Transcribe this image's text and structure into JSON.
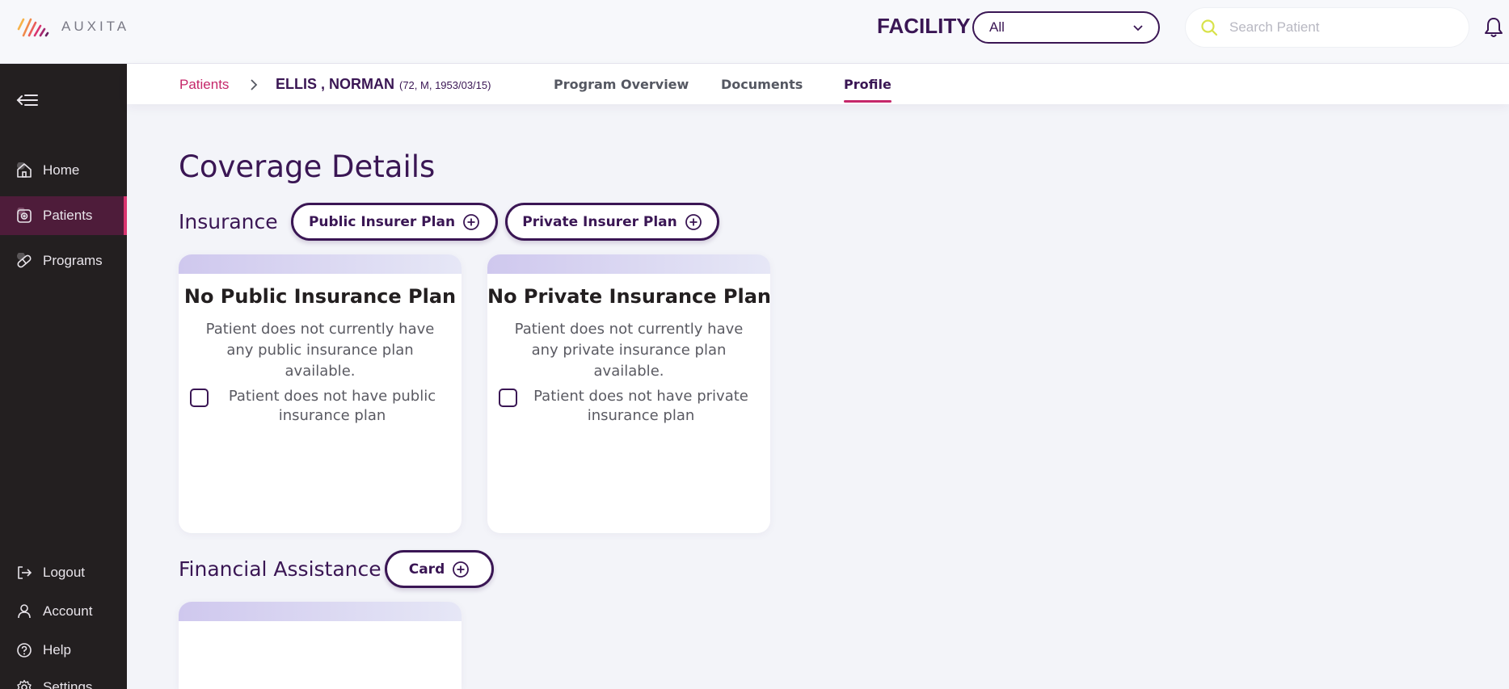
{
  "app": {
    "logo_text": "AUXITA"
  },
  "header": {
    "facility_label": "FACILITY",
    "facility_value": "All",
    "search_placeholder": "Search Patient"
  },
  "sidebar": {
    "items": [
      {
        "label": "Home",
        "icon": "home-icon"
      },
      {
        "label": "Patients",
        "icon": "patients-icon",
        "active": true
      },
      {
        "label": "Programs",
        "icon": "pill-icon"
      },
      {
        "label": "Logout",
        "icon": "logout-icon"
      },
      {
        "label": "Account",
        "icon": "user-icon"
      },
      {
        "label": "Help",
        "icon": "help-icon"
      },
      {
        "label": "Settings",
        "icon": "gear-icon"
      }
    ]
  },
  "breadcrumb": {
    "root": "Patients",
    "patient_name": "ELLIS , NORMAN",
    "patient_meta": "(72, M, 1953/03/15)"
  },
  "tabs": [
    {
      "label": "Program Overview"
    },
    {
      "label": "Documents"
    },
    {
      "label": "Profile",
      "active": true
    }
  ],
  "main": {
    "title": "Coverage Details",
    "insurance": {
      "label": "Insurance",
      "public_button": "Public Insurer Plan",
      "private_button": "Private Insurer Plan",
      "public_card": {
        "title": "No Public Insurance Plan",
        "description": "Patient does not currently have any public insurance plan available.",
        "checkbox_label": "Patient does not have public insurance plan"
      },
      "private_card": {
        "title": "No Private Insurance Plan",
        "description": "Patient does not currently have any private insurance plan available.",
        "checkbox_label": "Patient does not have private insurance plan"
      }
    },
    "financial": {
      "label": "Financial Assistance",
      "card_button": "Card"
    }
  },
  "colors": {
    "primary": "#3a1654",
    "accent": "#c5276a",
    "sidebar_bg": "#231f20",
    "sidebar_active": "#4e1c3a"
  }
}
